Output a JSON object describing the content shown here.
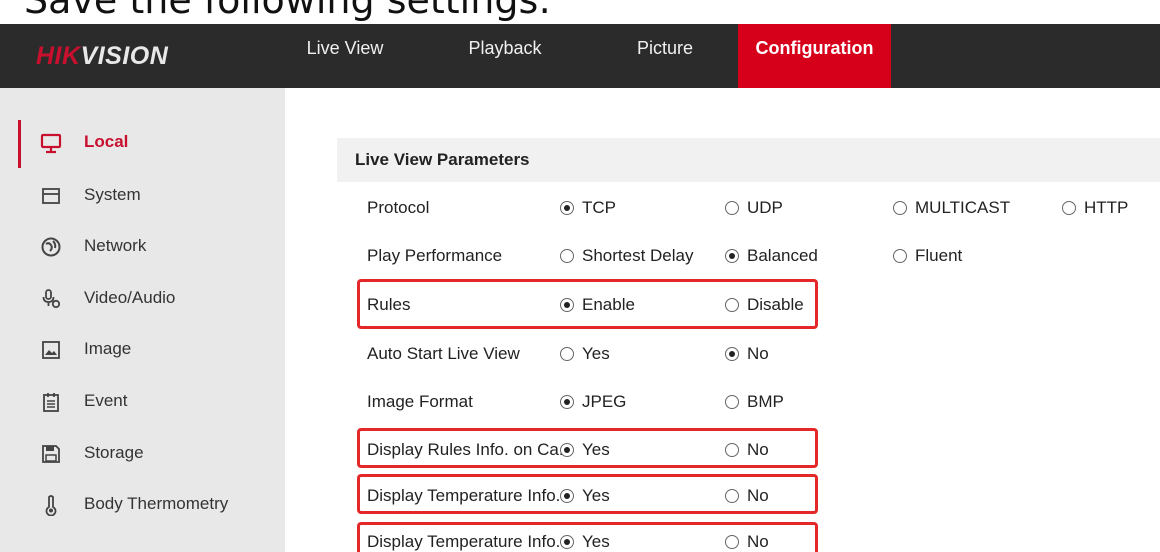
{
  "caption": "Save the following settings:",
  "brand": {
    "logo_red": "HIK",
    "logo_rest": "VISION"
  },
  "nav": {
    "tabs": [
      {
        "label": "Live View"
      },
      {
        "label": "Playback"
      },
      {
        "label": "Picture"
      },
      {
        "label": "Configuration",
        "active": true
      }
    ]
  },
  "sidebar": {
    "items": [
      {
        "label": "Local",
        "icon": "monitor-icon",
        "active": true
      },
      {
        "label": "System",
        "icon": "system-icon"
      },
      {
        "label": "Network",
        "icon": "globe-icon"
      },
      {
        "label": "Video/Audio",
        "icon": "microphone-icon"
      },
      {
        "label": "Image",
        "icon": "image-icon"
      },
      {
        "label": "Event",
        "icon": "calendar-icon"
      },
      {
        "label": "Storage",
        "icon": "save-icon"
      },
      {
        "label": "Body Thermometry",
        "icon": "thermometer-icon"
      }
    ]
  },
  "main": {
    "section_title": "Live View Parameters",
    "rows": [
      {
        "label": "Protocol",
        "options": [
          "TCP",
          "UDP",
          "MULTICAST",
          "HTTP"
        ],
        "selected": "TCP"
      },
      {
        "label": "Play Performance",
        "options": [
          "Shortest Delay",
          "Balanced",
          "Fluent"
        ],
        "selected": "Balanced"
      },
      {
        "label": "Rules",
        "options": [
          "Enable",
          "Disable"
        ],
        "selected": "Enable",
        "highlighted": true
      },
      {
        "label": "Auto Start Live View",
        "options": [
          "Yes",
          "No"
        ],
        "selected": "No"
      },
      {
        "label": "Image Format",
        "options": [
          "JPEG",
          "BMP"
        ],
        "selected": "JPEG"
      },
      {
        "label": "Display Rules Info. on Ca...",
        "options": [
          "Yes",
          "No"
        ],
        "selected": "Yes",
        "highlighted": true
      },
      {
        "label": "Display Temperature Info.",
        "options": [
          "Yes",
          "No"
        ],
        "selected": "Yes",
        "highlighted": true
      },
      {
        "label": "Display Temperature Info...",
        "options": [
          "Yes",
          "No"
        ],
        "selected": "Yes",
        "highlighted": true
      }
    ]
  },
  "colors": {
    "brand_red": "#d7001b",
    "navbar": "#2b2b2b",
    "sidebar": "#e8e8e8",
    "highlight": "#e4282a"
  }
}
